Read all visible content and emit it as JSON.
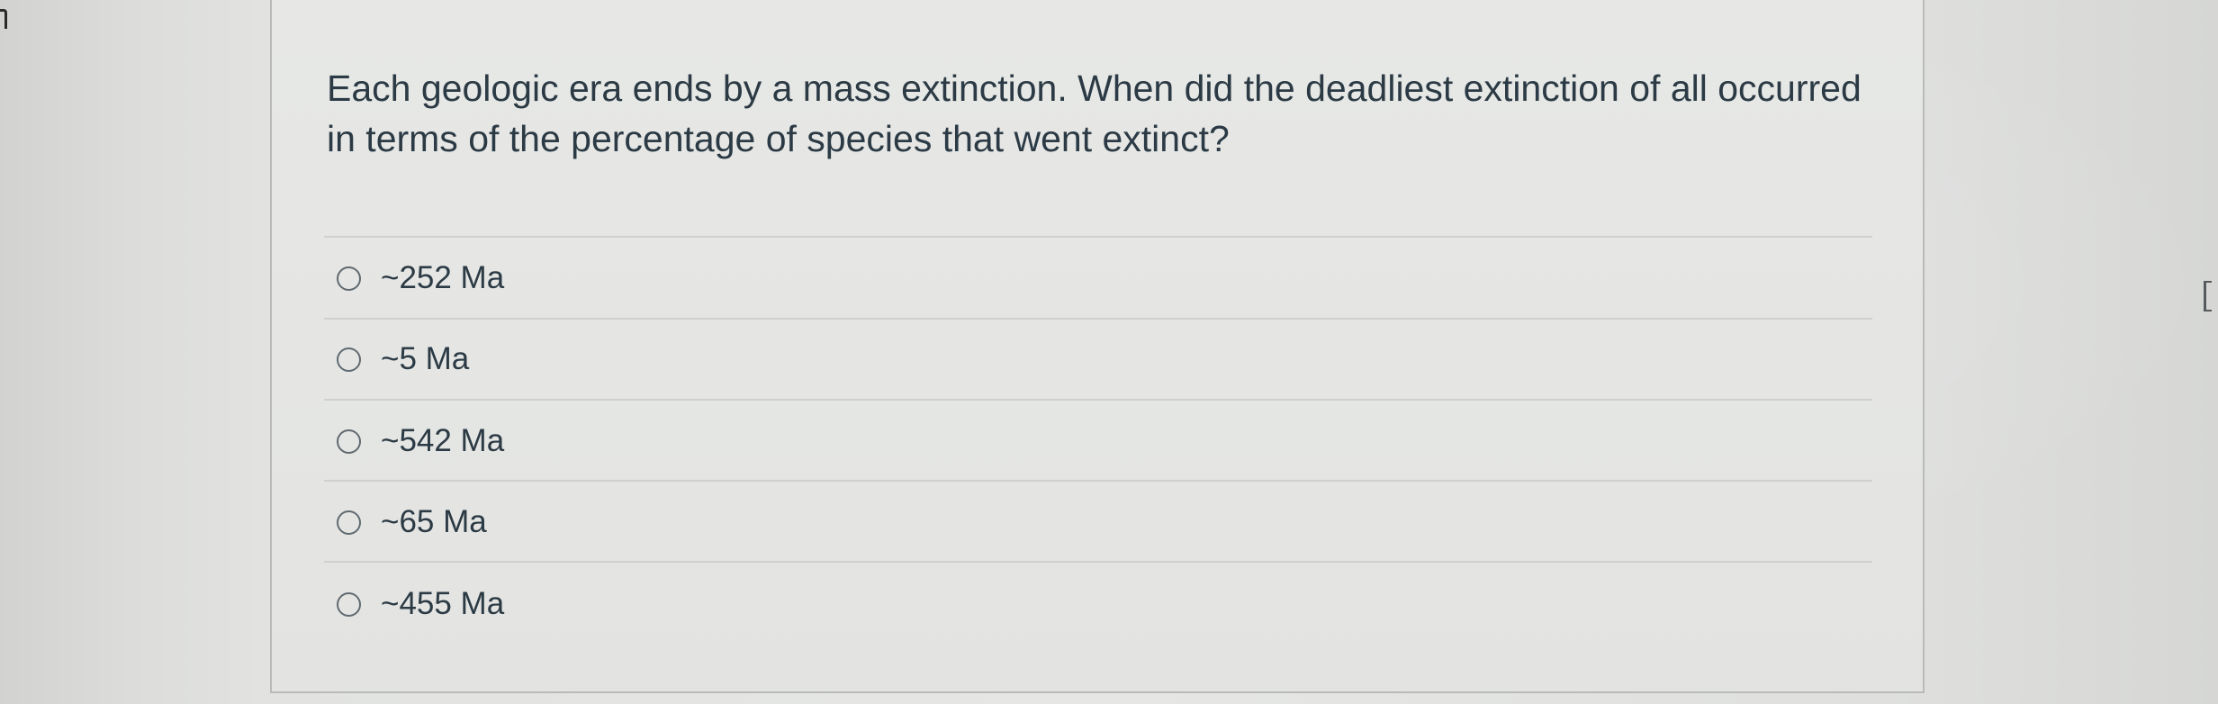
{
  "question": {
    "text": "Each geologic era ends by a mass extinction. When did the deadliest extinction of all occurred in terms of the percentage of species that went extinct?"
  },
  "answers": [
    {
      "label": "~252 Ma",
      "selected": false
    },
    {
      "label": "~5 Ma",
      "selected": false
    },
    {
      "label": "~542 Ma",
      "selected": false
    },
    {
      "label": "~65 Ma",
      "selected": false
    },
    {
      "label": "~455 Ma",
      "selected": false
    }
  ],
  "colors": {
    "text": "#2b3a44",
    "card_border": "#b9bbba",
    "divider": "#cfd1cf",
    "radio_border": "#606a70"
  }
}
